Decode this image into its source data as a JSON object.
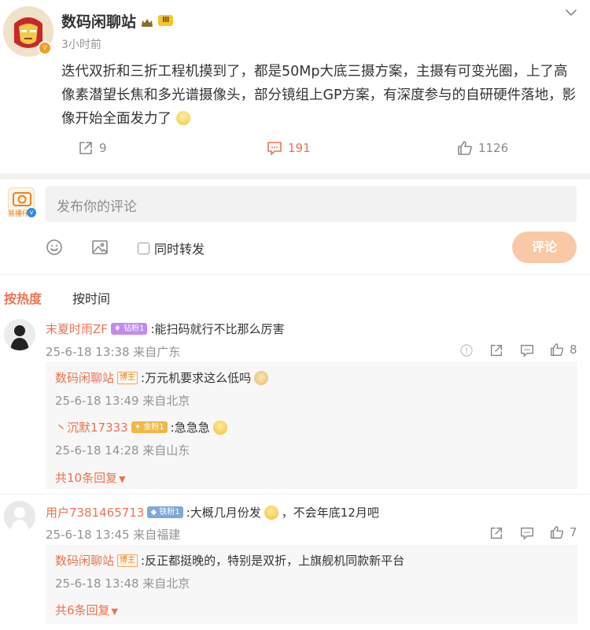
{
  "post": {
    "author": "数码闲聊站",
    "level_badge": "Ⅲ",
    "time": "3小时前",
    "content": "迭代双折和三折工程机摸到了，都是50Mp大底三摄方案，主摄有可变光圈，上了高像素潜望长焦和多光谱摄像头，部分镜组上GP方案，有深度参与的自研硬件落地，影像开始全面发力了",
    "stats": {
      "repost": "9",
      "comment": "191",
      "like": "1126"
    }
  },
  "composer": {
    "placeholder": "发布你的评论",
    "repost_label": "同时转发",
    "submit_label": "评论",
    "avatar_text": "易播仔"
  },
  "sort_tabs": {
    "hot": "按热度",
    "time": "按时间"
  },
  "comments": [
    {
      "name": "末夏时雨ZF",
      "badge": "钻粉1",
      "text": ":能扫码就行不比那么厉害",
      "meta": "25-6-18 13:38 来自广东",
      "likes": "8",
      "replies": [
        {
          "name": "数码闲聊站",
          "badge": "博主",
          "text": ":万元机要求这么低吗",
          "meta": "25-6-18 13:49 来自北京"
        },
        {
          "name": "丶沉默17333",
          "badge": "金粉1",
          "text": ":急急急",
          "meta": "25-6-18 14:28 来自山东"
        }
      ],
      "more": "共10条回复"
    },
    {
      "name": "用户7381465713",
      "badge": "铁粉1",
      "text_a": ":大概几月份发",
      "text_b": "，不会年底12月吧",
      "meta": "25-6-18 13:45 来自福建",
      "likes": "7",
      "replies": [
        {
          "name": "数码闲聊站",
          "badge": "博主",
          "text": ":反正都挺晚的，特别是双折，上旗舰机同款新平台",
          "meta": "25-6-18 13:48 来自北京"
        }
      ],
      "more": "共6条回复"
    }
  ],
  "colors": {
    "accent": "#eb7350",
    "button": "#f9c8a6",
    "divider": "#f2f2f2"
  }
}
